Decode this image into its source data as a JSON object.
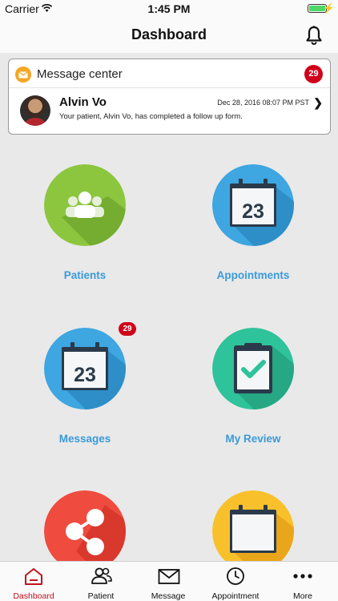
{
  "status_bar": {
    "carrier": "Carrier",
    "time": "1:45 PM"
  },
  "nav": {
    "title": "Dashboard"
  },
  "message_center": {
    "title": "Message center",
    "count": "29",
    "sender": "Alvin Vo",
    "date": "Dec 28, 2016 08:07 PM PST",
    "preview": "Your patient, Alvin Vo, has completed a follow up form."
  },
  "tiles": [
    {
      "label": "Patients",
      "icon": "patients-icon",
      "color": "#8cc63f"
    },
    {
      "label": "Appointments",
      "icon": "calendar-icon",
      "color": "#3ea6e0",
      "day": "23"
    },
    {
      "label": "Messages",
      "icon": "calendar-icon",
      "color": "#3ea6e0",
      "day": "23",
      "badge": "29"
    },
    {
      "label": "My Review",
      "icon": "clipboard-check-icon",
      "color": "#2ec39a"
    },
    {
      "label": "",
      "icon": "share-icon",
      "color": "#ef4b3f"
    },
    {
      "label": "",
      "icon": "blank-calendar-icon",
      "color": "#f8c12c"
    }
  ],
  "tabbar": {
    "items": [
      {
        "label": "Dashboard",
        "icon": "home-icon",
        "active": true
      },
      {
        "label": "Patient",
        "icon": "people-icon"
      },
      {
        "label": "Message",
        "icon": "envelope-icon"
      },
      {
        "label": "Appointment",
        "icon": "clock-icon"
      },
      {
        "label": "More",
        "icon": "more-dots-icon"
      }
    ]
  },
  "colors": {
    "accent": "#c1121f",
    "link": "#3a9ad9",
    "badge": "#d0021b"
  }
}
